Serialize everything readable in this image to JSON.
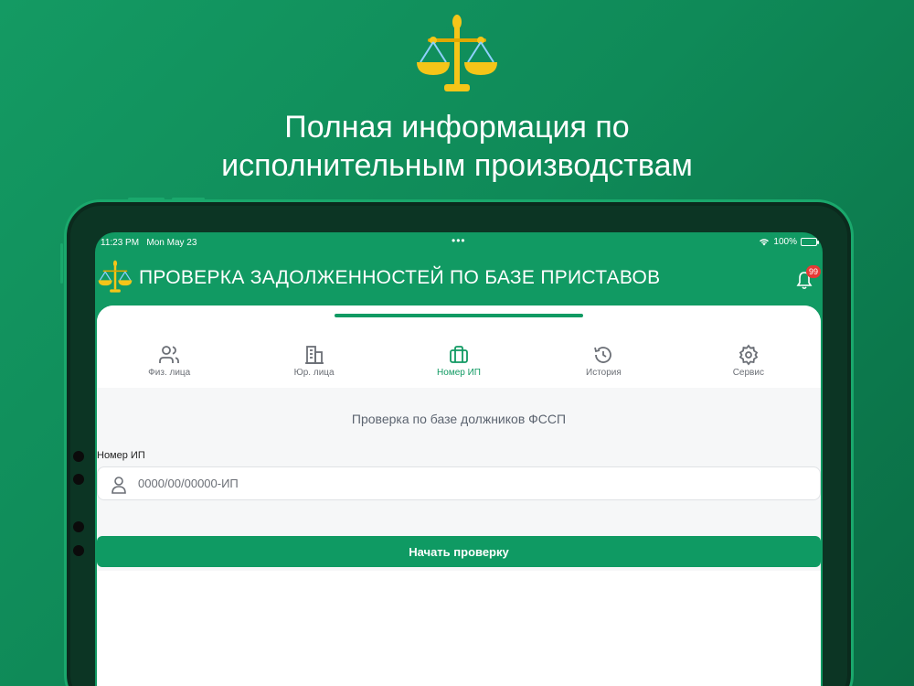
{
  "hero": {
    "title_line1": "Полная информация по",
    "title_line2": "исполнительным производствам"
  },
  "status_bar": {
    "time": "11:23 PM",
    "date": "Mon May 23",
    "center_dots": "•••",
    "battery": "100%"
  },
  "app_bar": {
    "title": "ПРОВЕРКА ЗАДОЛЖЕННОСТЕЙ ПО БАЗЕ ПРИСТАВОВ",
    "notifications_count": "99"
  },
  "tabs": [
    {
      "label": "Физ. лица",
      "icon": "users-icon",
      "active": false
    },
    {
      "label": "Юр. лица",
      "icon": "building-icon",
      "active": false
    },
    {
      "label": "Номер ИП",
      "icon": "briefcase-icon",
      "active": true
    },
    {
      "label": "История",
      "icon": "history-icon",
      "active": false
    },
    {
      "label": "Сервис",
      "icon": "gear-icon",
      "active": false
    }
  ],
  "form": {
    "subtitle": "Проверка по базе должников ФССП",
    "field_label": "Номер ИП",
    "field_placeholder": "0000/00/00000-ИП",
    "field_value": "",
    "submit_label": "Начать проверку"
  },
  "colors": {
    "brand_green": "#119a63",
    "badge_red": "#e53935",
    "scale_gold": "#f5c518"
  }
}
